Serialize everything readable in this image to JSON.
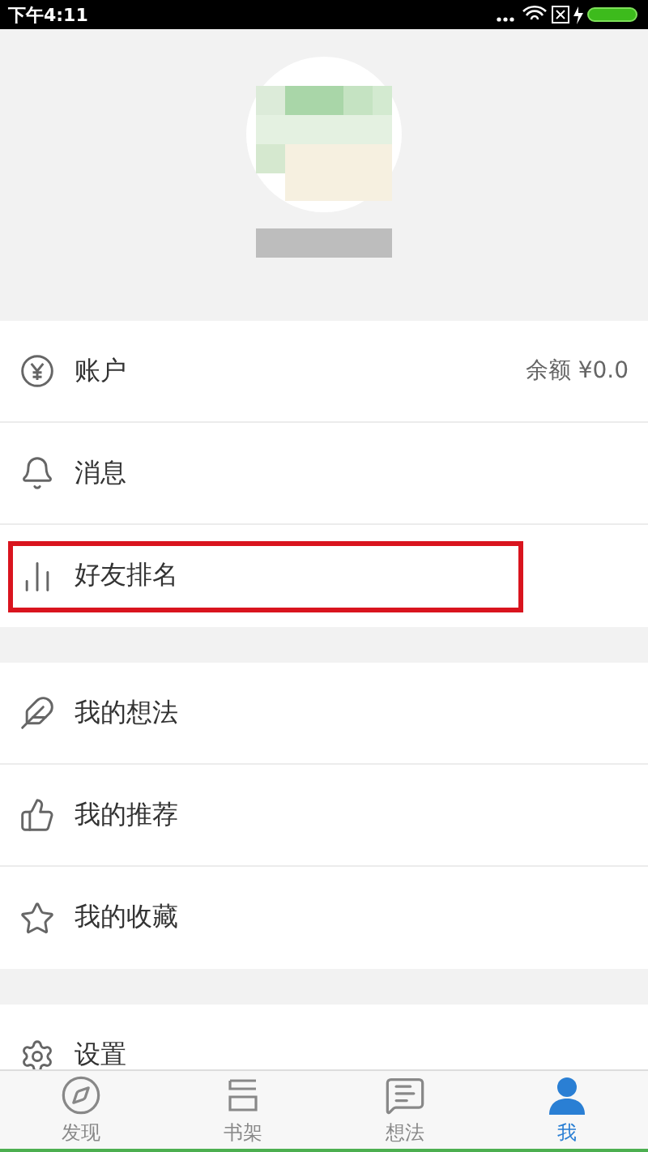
{
  "status_bar": {
    "time": "下午4:11"
  },
  "sections": [
    {
      "items": [
        {
          "kind": "account",
          "label": "账户",
          "value": "余额 ¥0.0",
          "highlighted": false
        },
        {
          "kind": "messages",
          "label": "消息",
          "highlighted": false
        },
        {
          "kind": "ranking",
          "label": "好友排名",
          "highlighted": true
        }
      ]
    },
    {
      "items": [
        {
          "kind": "thoughts",
          "label": "我的想法",
          "highlighted": false
        },
        {
          "kind": "recommend",
          "label": "我的推荐",
          "highlighted": false
        },
        {
          "kind": "favorites",
          "label": "我的收藏",
          "highlighted": false
        }
      ]
    },
    {
      "items": [
        {
          "kind": "settings",
          "label": "设置",
          "highlighted": false
        }
      ]
    }
  ],
  "tabs": [
    {
      "kind": "discover",
      "label": "发现",
      "selected": false
    },
    {
      "kind": "shelf",
      "label": "书架",
      "selected": false
    },
    {
      "kind": "thoughts",
      "label": "想法",
      "selected": false
    },
    {
      "kind": "me",
      "label": "我",
      "selected": true
    }
  ]
}
